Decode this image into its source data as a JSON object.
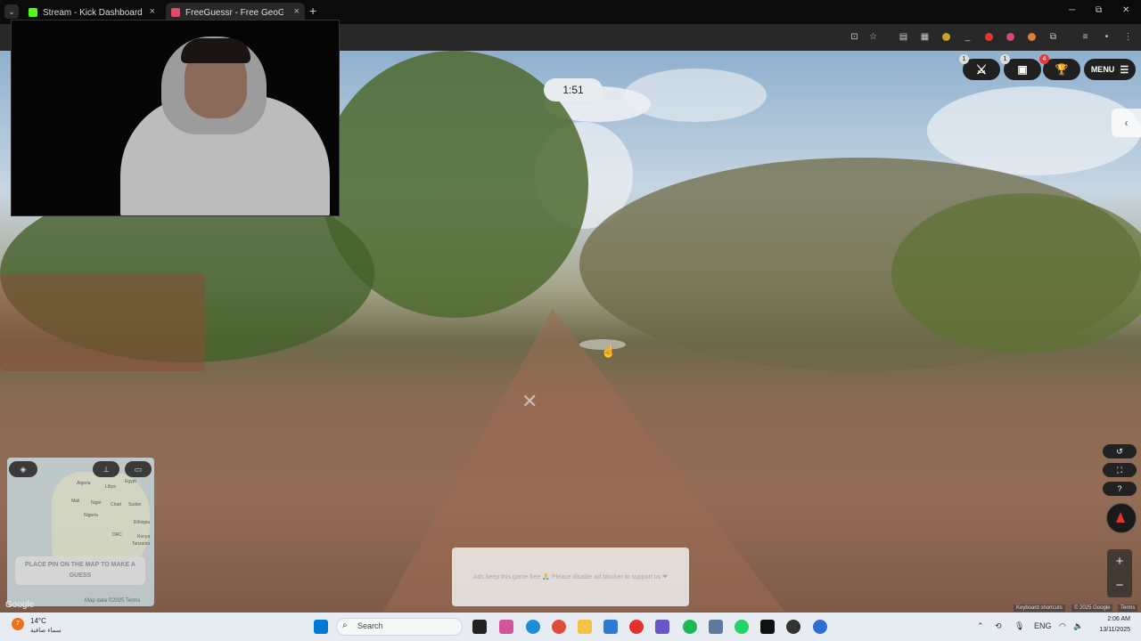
{
  "browser": {
    "tabs": [
      {
        "title": "Stream - Kick Dashboard",
        "favicon_color": "#53fc18",
        "close": "×"
      },
      {
        "title": "FreeGuessr - Free GeoGuessr Al",
        "favicon_color": "#e0496a",
        "close": "×"
      }
    ],
    "new_tab": "+",
    "tab_menu": "⌄",
    "window_controls": {
      "minimize": "─",
      "maximize": "⧉",
      "close": "✕"
    },
    "toolbar_icons": [
      "install-icon",
      "star-icon",
      "extension-1-icon",
      "extension-2-icon",
      "extension-3-icon",
      "extension-4-icon",
      "extension-5-icon",
      "extension-6-icon",
      "extensions-icon",
      "media-icon",
      "profile-icon",
      "menu-icon"
    ]
  },
  "game": {
    "timer": "1:51",
    "buttons": {
      "battle": {
        "icon": "crossed-swords-icon",
        "badge": "1"
      },
      "shop": {
        "icon": "shop-icon",
        "badge": "1"
      },
      "trophy": {
        "icon": "trophy-icon",
        "badge": "4"
      },
      "menu": {
        "label": "MENU",
        "icon": "hamburger-icon"
      }
    },
    "side_toggle": "‹",
    "minimap": {
      "labels": [
        "Algeria",
        "Egypt",
        "Libya",
        "Mali",
        "Niger",
        "Chad",
        "Sudan",
        "Nigeria",
        "DRC",
        "Ethiopia",
        "Kenya",
        "Tanzania"
      ],
      "place_pin_message": "PLACE PIN ON THE MAP TO MAKE A GUESS",
      "google": "Google",
      "map_data": "Map data ©2025   Terms"
    },
    "ad_message": "Ads keep this game free 🙏 Please disable ad blocker to support us ❤",
    "controls": {
      "undo": "↺",
      "fullscreen": "⛶",
      "help": "?",
      "zoom_in": "+",
      "zoom_out": "−"
    },
    "attribution": [
      "Keyboard shortcuts",
      "© 2025 Google",
      "Terms"
    ]
  },
  "taskbar": {
    "weather": {
      "badge": "7",
      "temp": "14°C",
      "desc": "سماء صافية"
    },
    "search_placeholder": "Search",
    "language": "ENG",
    "time": "2:06 AM",
    "date": "13/11/2025",
    "accent": "#0078d4"
  }
}
